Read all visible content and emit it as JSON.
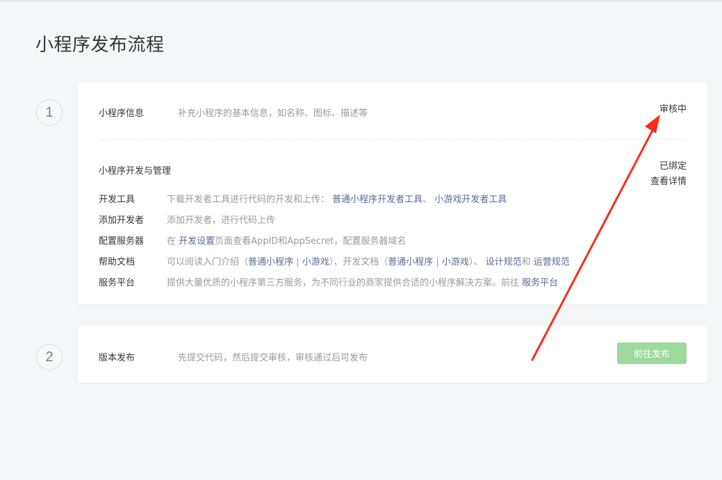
{
  "page": {
    "title": "小程序发布流程"
  },
  "steps": [
    {
      "number": "1"
    },
    {
      "number": "2"
    }
  ],
  "info": {
    "label": "小程序信息",
    "desc": "补充小程序的基本信息，如名称、图标、描述等",
    "status": "审核中"
  },
  "dev": {
    "title": "小程序开发与管理",
    "status": "已绑定",
    "detail_link": "查看详情",
    "rows": {
      "tools": {
        "label": "开发工具",
        "desc": "下载开发者工具进行代码的开发和上传：",
        "link1": "普通小程序开发者工具",
        "sep": "、",
        "link2": "小游戏开发者工具"
      },
      "developers": {
        "label": "添加开发者",
        "desc": "添加开发者，进行代码上传"
      },
      "servers": {
        "label": "配置服务器",
        "pre": "在",
        "link": "开发设置",
        "post": "页面查看AppID和AppSecret，配置服务器域名"
      },
      "help": {
        "label": "帮助文档",
        "pre": "可以阅读入门介绍（",
        "link1": "普通小程序",
        "sep1": "|",
        "link2": "小游戏",
        "mid": "）、开发文档（",
        "link3": "普通小程序",
        "sep2": "|",
        "link4": "小游戏",
        "mid2": "）、",
        "link5": "设计规范",
        "and": "和",
        "link6": "运营规范"
      },
      "services": {
        "label": "服务平台",
        "desc": "提供大量优质的小程序第三方服务，为不同行业的商家提供合适的小程序解决方案。前往",
        "link": "服务平台"
      }
    }
  },
  "release": {
    "label": "版本发布",
    "desc": "先提交代码，然后提交审核，审核通过后可发布",
    "button": "前往发布"
  },
  "colors": {
    "link": "#576b95",
    "button": "#9ed99d",
    "annotation_arrow": "#ff2a1a"
  },
  "icons": {
    "annotation": "red-arrow-icon"
  }
}
